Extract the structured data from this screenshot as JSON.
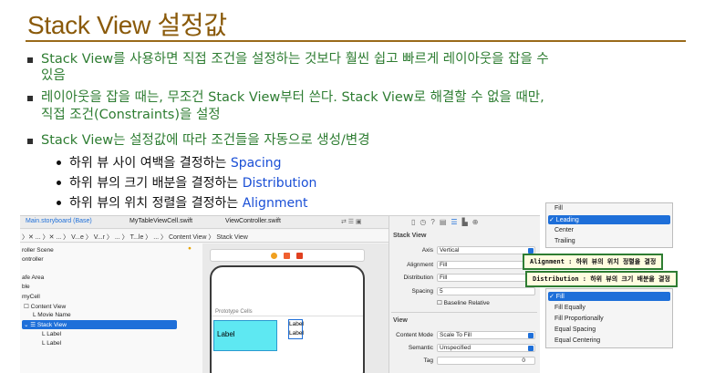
{
  "slide": {
    "title": "Stack View 설정값",
    "bullets": [
      "Stack View를 사용하면 직접 조건을 설정하는 것보다 훨씬 쉽고 빠르게 레이아웃을 잡을 수",
      "있음",
      "레이아웃을 잡을 때는, 무조건 Stack View부터 쓴다. Stack View로 해결할 수 없을 때만,",
      "직접 조건(Constraints)을 설정",
      "Stack View는 설정값에 따라 조건들을 자동으로 생성/변경"
    ],
    "subs": [
      {
        "pre": "하위 뷰 사이 여백을 결정하는 ",
        "kw": "Spacing"
      },
      {
        "pre": "하위 뷰의 크기 배분을 결정하는 ",
        "kw": "Distribution"
      },
      {
        "pre": "하위 뷰의 위치 정렬을 결정하는 ",
        "kw": "Alignment"
      }
    ]
  },
  "xcode": {
    "tabs": [
      "Main.storyboard (Base)",
      "MyTableViewCell.swift",
      "ViewController.swift"
    ],
    "breadcrumb": "〉✕ ... 〉✕ ... 〉 V...e 〉 V...r 〉 ... 〉 T...le 〉 ... 〉 Content View 〉 Stack View",
    "outline": [
      "roller Scene",
      "ontroller",
      "afe Area",
      "ble",
      "myCell",
      "Content View",
      "Movie Name",
      "Stack View",
      "Label",
      "Label"
    ],
    "canvas": {
      "section": "Prototype Cells",
      "label_main": "Label",
      "label_a": "Label",
      "label_b": "Label"
    },
    "inspector": {
      "stack_header": "Stack View",
      "rows": [
        {
          "label": "Axis",
          "value": "Vertical"
        },
        {
          "label": "Alignment",
          "value": "Fill"
        },
        {
          "label": "Distribution",
          "value": "Fill"
        },
        {
          "label": "Spacing",
          "value": "5"
        }
      ],
      "baseline": "Baseline Relative",
      "view_header": "View",
      "view_rows": [
        {
          "label": "Content Mode",
          "value": "Scale To Fill"
        },
        {
          "label": "Semantic",
          "value": "Unspecified"
        },
        {
          "label": "Tag",
          "value": "0"
        }
      ]
    }
  },
  "alignment_menu": [
    "Fill",
    "✓ Leading",
    "Center",
    "Trailing"
  ],
  "distribution_menu": [
    "✓ Fill",
    "Fill Equally",
    "Fill Proportionally",
    "Equal Spacing",
    "Equal Centering"
  ],
  "callouts": {
    "alignment": "Alignment : 하위 뷰의 위치 정렬을 결정",
    "distribution": "Distribution : 하위 뷰의 크기 배분을 결정"
  },
  "colors": {
    "title": "#8a5a0a",
    "bullet_text": "#2e7d32",
    "keyword": "#1a4fd6",
    "selection": "#1e6fd9"
  }
}
